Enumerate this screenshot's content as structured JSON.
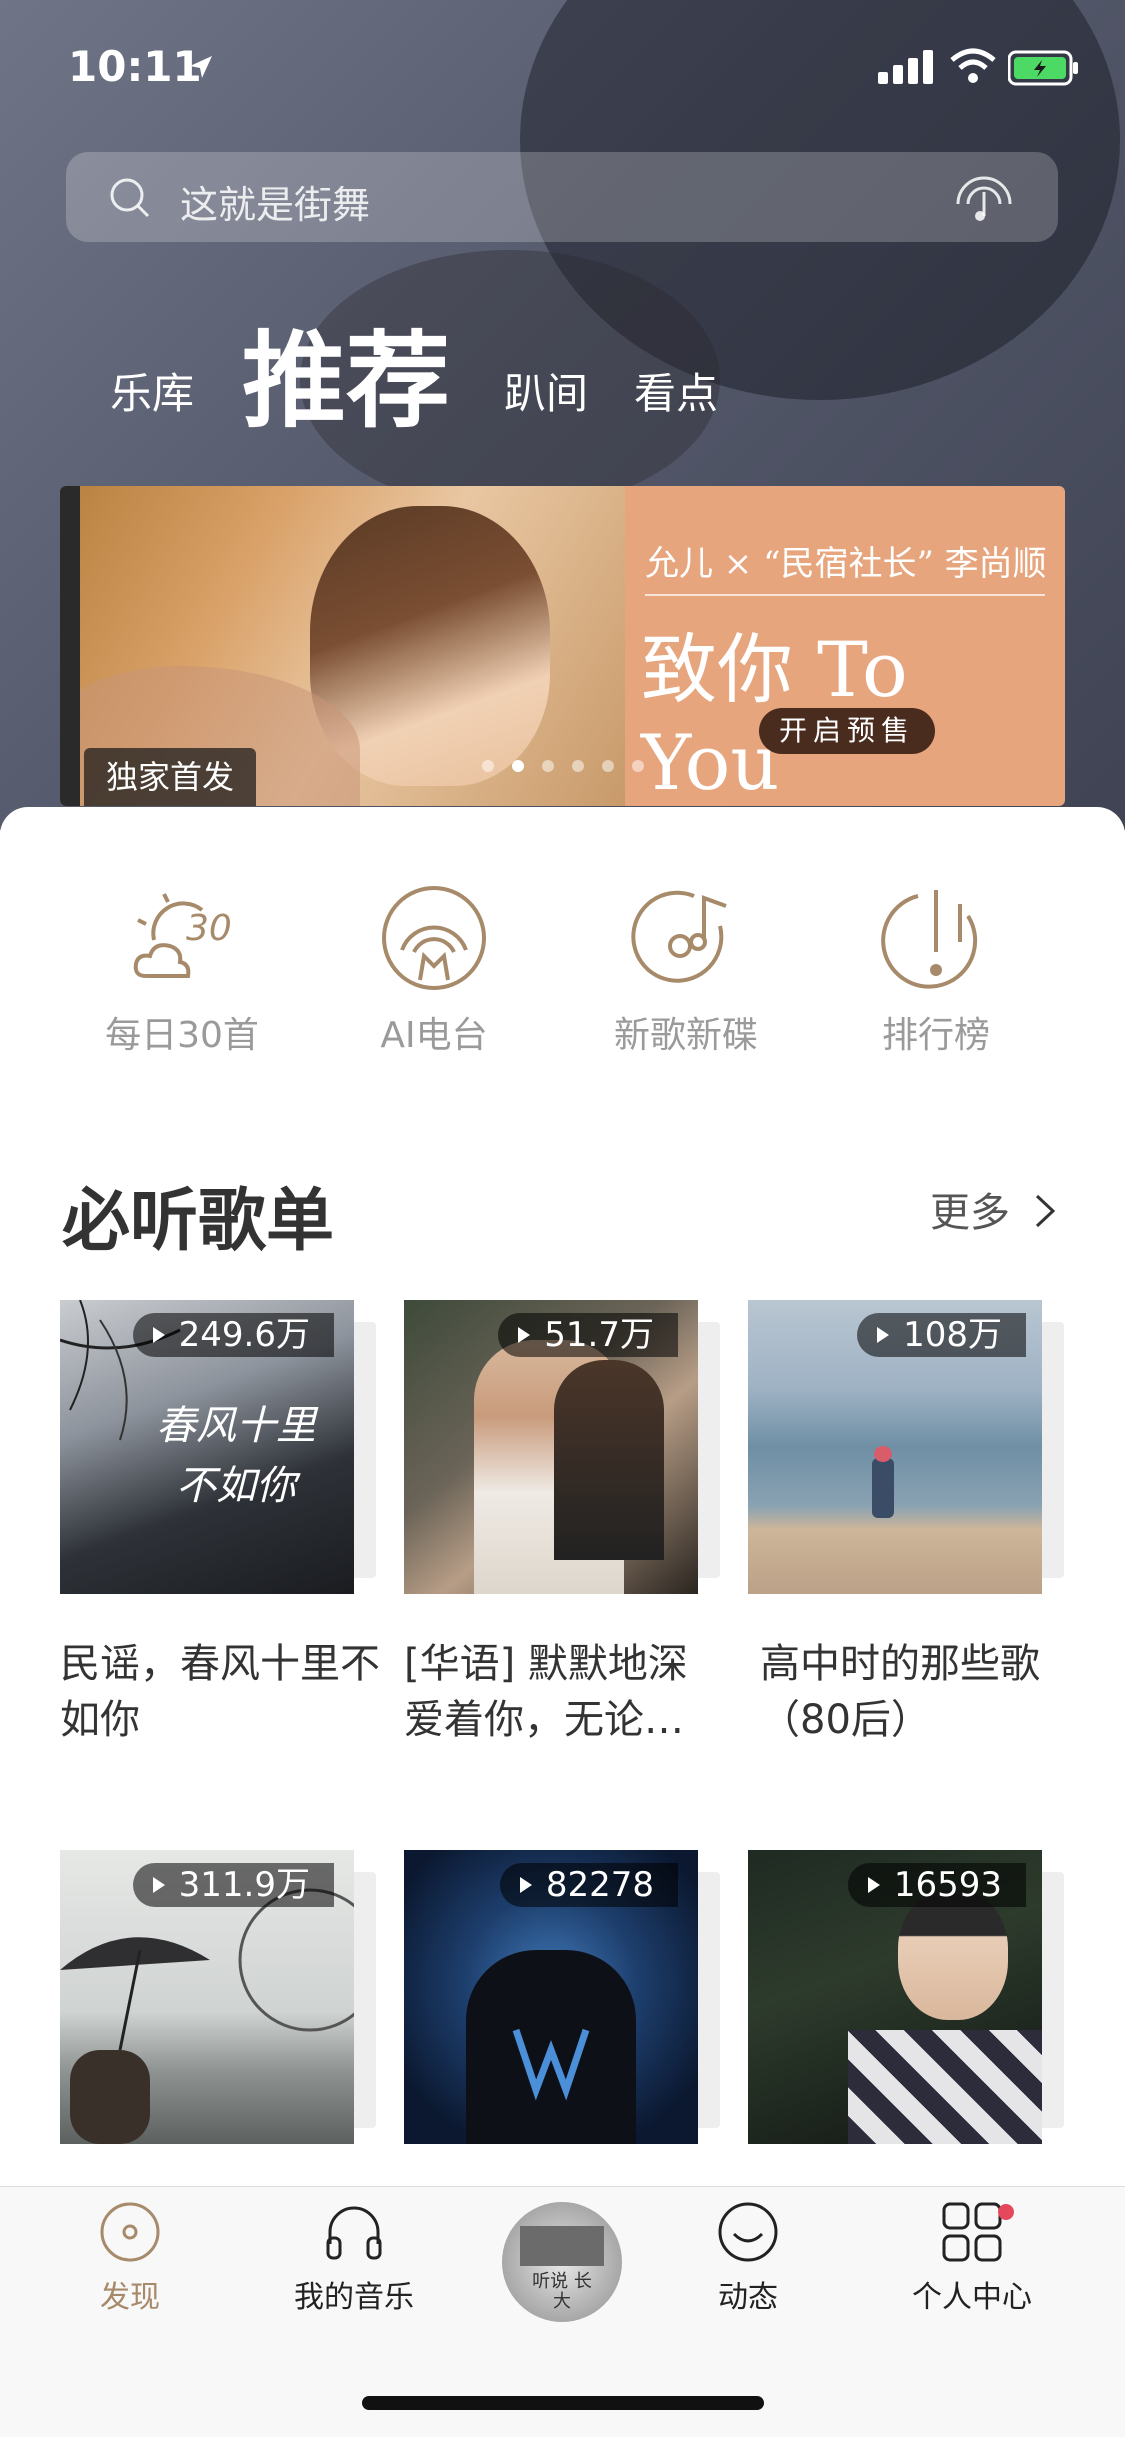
{
  "status_bar": {
    "time": "10:11"
  },
  "search": {
    "placeholder": "这就是街舞"
  },
  "tabs": [
    {
      "label": "乐库"
    },
    {
      "label": "推荐"
    },
    {
      "label": "趴间"
    },
    {
      "label": "看点"
    }
  ],
  "banner": {
    "subtitle": "允儿 × “民宿社长” 李尚顺",
    "title": "致你 To You",
    "button": "开启预售",
    "badge": "独家首发",
    "dot_count": 6,
    "active_dot": 1
  },
  "quick_actions": [
    {
      "label": "每日30首",
      "icon": "daily-sun-icon"
    },
    {
      "label": "AI电台",
      "icon": "radio-icon"
    },
    {
      "label": "新歌新碟",
      "icon": "disc-note-icon"
    },
    {
      "label": "排行榜",
      "icon": "ranking-icon"
    }
  ],
  "section": {
    "title": "必听歌单",
    "more": "更多"
  },
  "playlists": [
    {
      "plays": "249.6万",
      "title": "民谣，春风十里不如你",
      "cover_text": "春风十里 不如你"
    },
    {
      "plays": "51.7万",
      "title": "[华语] 默默地深爱着你，无论…"
    },
    {
      "plays": "108万",
      "title": "高中时的那些歌（80后）"
    },
    {
      "plays": "311.9万",
      "title": ""
    },
    {
      "plays": "82278",
      "title": ""
    },
    {
      "plays": "16593",
      "title": ""
    }
  ],
  "cover_art_text": "听说 长大",
  "tab_bar": [
    {
      "label": "发现",
      "icon": "discover-icon",
      "active": true
    },
    {
      "label": "我的音乐",
      "icon": "headphones-icon"
    },
    {
      "label": "",
      "icon": "now-playing-disc"
    },
    {
      "label": "动态",
      "icon": "smile-icon"
    },
    {
      "label": "个人中心",
      "icon": "grid-icon",
      "badge": true
    }
  ],
  "colors": {
    "accent": "#a68a6a",
    "hero_bg": "#5a5f71",
    "banner_orange": "#e7a57e"
  }
}
